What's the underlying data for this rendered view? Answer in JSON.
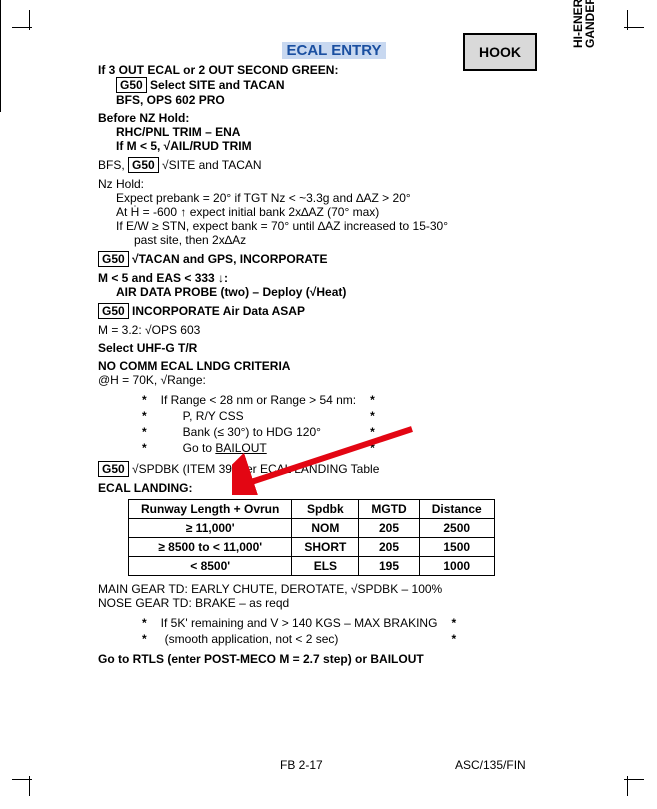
{
  "title": "ECAL ENTRY",
  "hook": "HOOK",
  "side_label": "HI-ENER\nGANDER",
  "s1": {
    "l1": "If 3 OUT ECAL or 2 OUT SECOND GREEN:",
    "g": "G50",
    "l2": " Select SITE and TACAN",
    "l3": "BFS, OPS 602 PRO"
  },
  "s2": {
    "l1": "Before NZ Hold:",
    "l2": "RHC/PNL TRIM – ENA",
    "l3": "If M < 5, √AIL/RUD TRIM"
  },
  "s3": {
    "pre": "BFS, ",
    "g": "G50",
    "post": " √SITE and TACAN"
  },
  "s4": {
    "h": "Nz Hold:",
    "l1": "Expect prebank = 20° if TGT Nz < ~3.3g and ∆AZ > 20°",
    "l2": "At Ḣ = -600 ↑ expect initial bank 2x∆AZ (70° max)",
    "l3": "If E/W ≥ STN, expect bank = 70° until ∆AZ increased to 15-30°",
    "l4": "past site, then 2x∆Az"
  },
  "s5": {
    "g": "G50",
    "t": "√TACAN and GPS, INCORPORATE"
  },
  "s6": {
    "l1": "M < 5 and EAS < 333 ↓:",
    "l2": "AIR DATA PROBE (two) – Deploy (√Heat)"
  },
  "s7": {
    "g": "G50",
    "t": "INCORPORATE Air Data ASAP"
  },
  "s8": "M = 3.2:  √OPS 603",
  "s9": "Select UHF-G T/R",
  "s10": {
    "h": "NO COMM ECAL LNDG CRITERIA",
    "l": "@H = 70K, √Range:"
  },
  "criteria": {
    "r1": "If Range < 28 nm or Range > 54 nm:",
    "r2": "P, R/Y CSS",
    "r3": "Bank (≤ 30°) to HDG 120°",
    "r4pre": "Go to ",
    "r4link": "BAILOUT"
  },
  "s11": {
    "g": "G50",
    "t": "√SPDBK (ITEM 39) per ECAL LANDING Table"
  },
  "tbl": {
    "title": "ECAL LANDING:",
    "cols": [
      "Runway Length + Ovrun",
      "Spdbk",
      "MGTD",
      "Distance"
    ],
    "rows": [
      {
        "c0": "≥ 11,000'",
        "c1": "NOM",
        "c2": "205",
        "c3": "2500"
      },
      {
        "c0": "≥ 8500 to < 11,000'",
        "c1": "SHORT",
        "c2": "205",
        "c3": "1500"
      },
      {
        "c0": "< 8500'",
        "c1": "ELS",
        "c2": "195",
        "c3": "1000"
      }
    ]
  },
  "s12": {
    "l1": "MAIN GEAR TD:  EARLY CHUTE, DEROTATE, √SPDBK – 100%",
    "l2": "NOSE GEAR TD:  BRAKE – as reqd"
  },
  "s13": {
    "l1": "If 5K' remaining and V > 140 KGS – MAX BRAKING",
    "l2": "(smooth application, not < 2 sec)"
  },
  "s14": "Go to RTLS (enter POST-MECO M = 2.7 step) or BAILOUT",
  "footer": {
    "left": "FB 2-17",
    "right": "ASC/135/FIN"
  },
  "star": "*"
}
